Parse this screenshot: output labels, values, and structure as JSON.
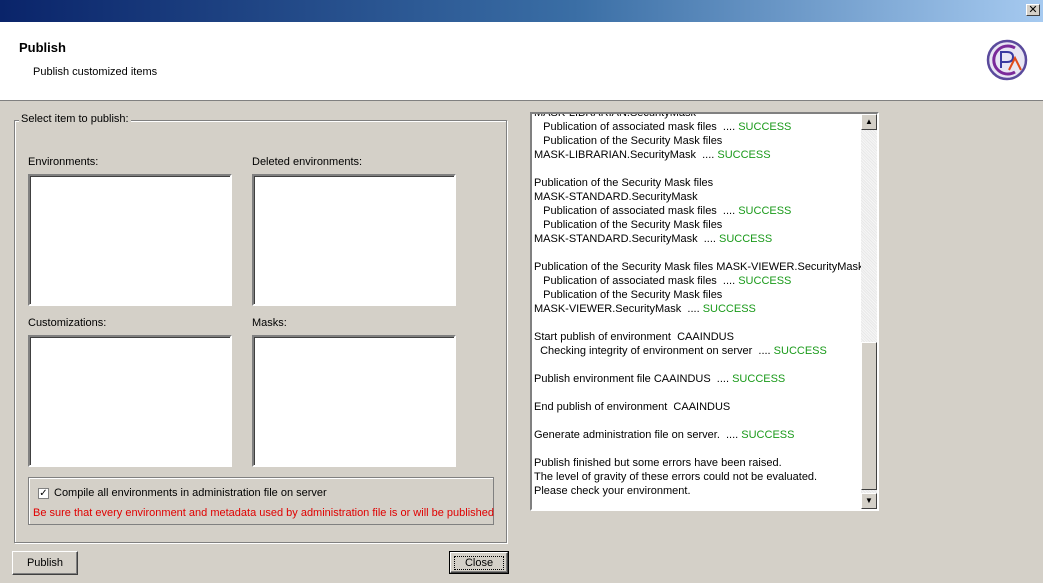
{
  "window": {
    "close_glyph": "✕"
  },
  "header": {
    "title": "Publish",
    "subtitle": "Publish customized items",
    "logo_icon": "app-logo-icon"
  },
  "select_group": {
    "legend": "Select item to publish:",
    "environments_label": "Environments:",
    "deleted_environments_label": "Deleted environments:",
    "customizations_label": "Customizations:",
    "masks_label": "Masks:"
  },
  "compile": {
    "checked": true,
    "check_glyph": "✓",
    "label": "Compile all environments in administration file on server",
    "warning": "Be sure that every environment and metadata used by administration file is or will be published",
    "warning_color": "#e00000"
  },
  "buttons": {
    "publish": "Publish",
    "close": "Close"
  },
  "log": {
    "success_color": "#1a9a1a",
    "lines": [
      {
        "text": "MASK-LIBRARIAN.SecurityMask",
        "ok": ""
      },
      {
        "text": "   Publication of associated mask files  ....",
        "ok": "SUCCESS"
      },
      {
        "text": "   Publication of the Security Mask files",
        "ok": ""
      },
      {
        "text": "MASK-LIBRARIAN.SecurityMask  ....",
        "ok": "SUCCESS"
      },
      {
        "text": "",
        "ok": ""
      },
      {
        "text": "Publication of the Security Mask files",
        "ok": ""
      },
      {
        "text": "MASK-STANDARD.SecurityMask",
        "ok": ""
      },
      {
        "text": "   Publication of associated mask files  ....",
        "ok": "SUCCESS"
      },
      {
        "text": "   Publication of the Security Mask files",
        "ok": ""
      },
      {
        "text": "MASK-STANDARD.SecurityMask  ....",
        "ok": "SUCCESS"
      },
      {
        "text": "",
        "ok": ""
      },
      {
        "text": "Publication of the Security Mask files MASK-VIEWER.SecurityMask",
        "ok": ""
      },
      {
        "text": "   Publication of associated mask files  ....",
        "ok": "SUCCESS"
      },
      {
        "text": "   Publication of the Security Mask files",
        "ok": ""
      },
      {
        "text": "MASK-VIEWER.SecurityMask  ....",
        "ok": "SUCCESS"
      },
      {
        "text": "",
        "ok": ""
      },
      {
        "text": "Start publish of environment  CAAINDUS",
        "ok": ""
      },
      {
        "text": "  Checking integrity of environment on server  ....",
        "ok": "SUCCESS"
      },
      {
        "text": "",
        "ok": ""
      },
      {
        "text": "Publish environment file CAAINDUS  ....",
        "ok": "SUCCESS"
      },
      {
        "text": "",
        "ok": ""
      },
      {
        "text": "End publish of environment  CAAINDUS",
        "ok": ""
      },
      {
        "text": "",
        "ok": ""
      },
      {
        "text": "Generate administration file on server.  ....",
        "ok": "SUCCESS"
      },
      {
        "text": "",
        "ok": ""
      },
      {
        "text": "Publish finished but some errors have been raised.",
        "ok": ""
      },
      {
        "text": "The level of gravity of these errors could not be evaluated.",
        "ok": ""
      },
      {
        "text": "Please check your environment.",
        "ok": ""
      }
    ],
    "scroll_up_glyph": "▲",
    "scroll_down_glyph": "▼"
  }
}
